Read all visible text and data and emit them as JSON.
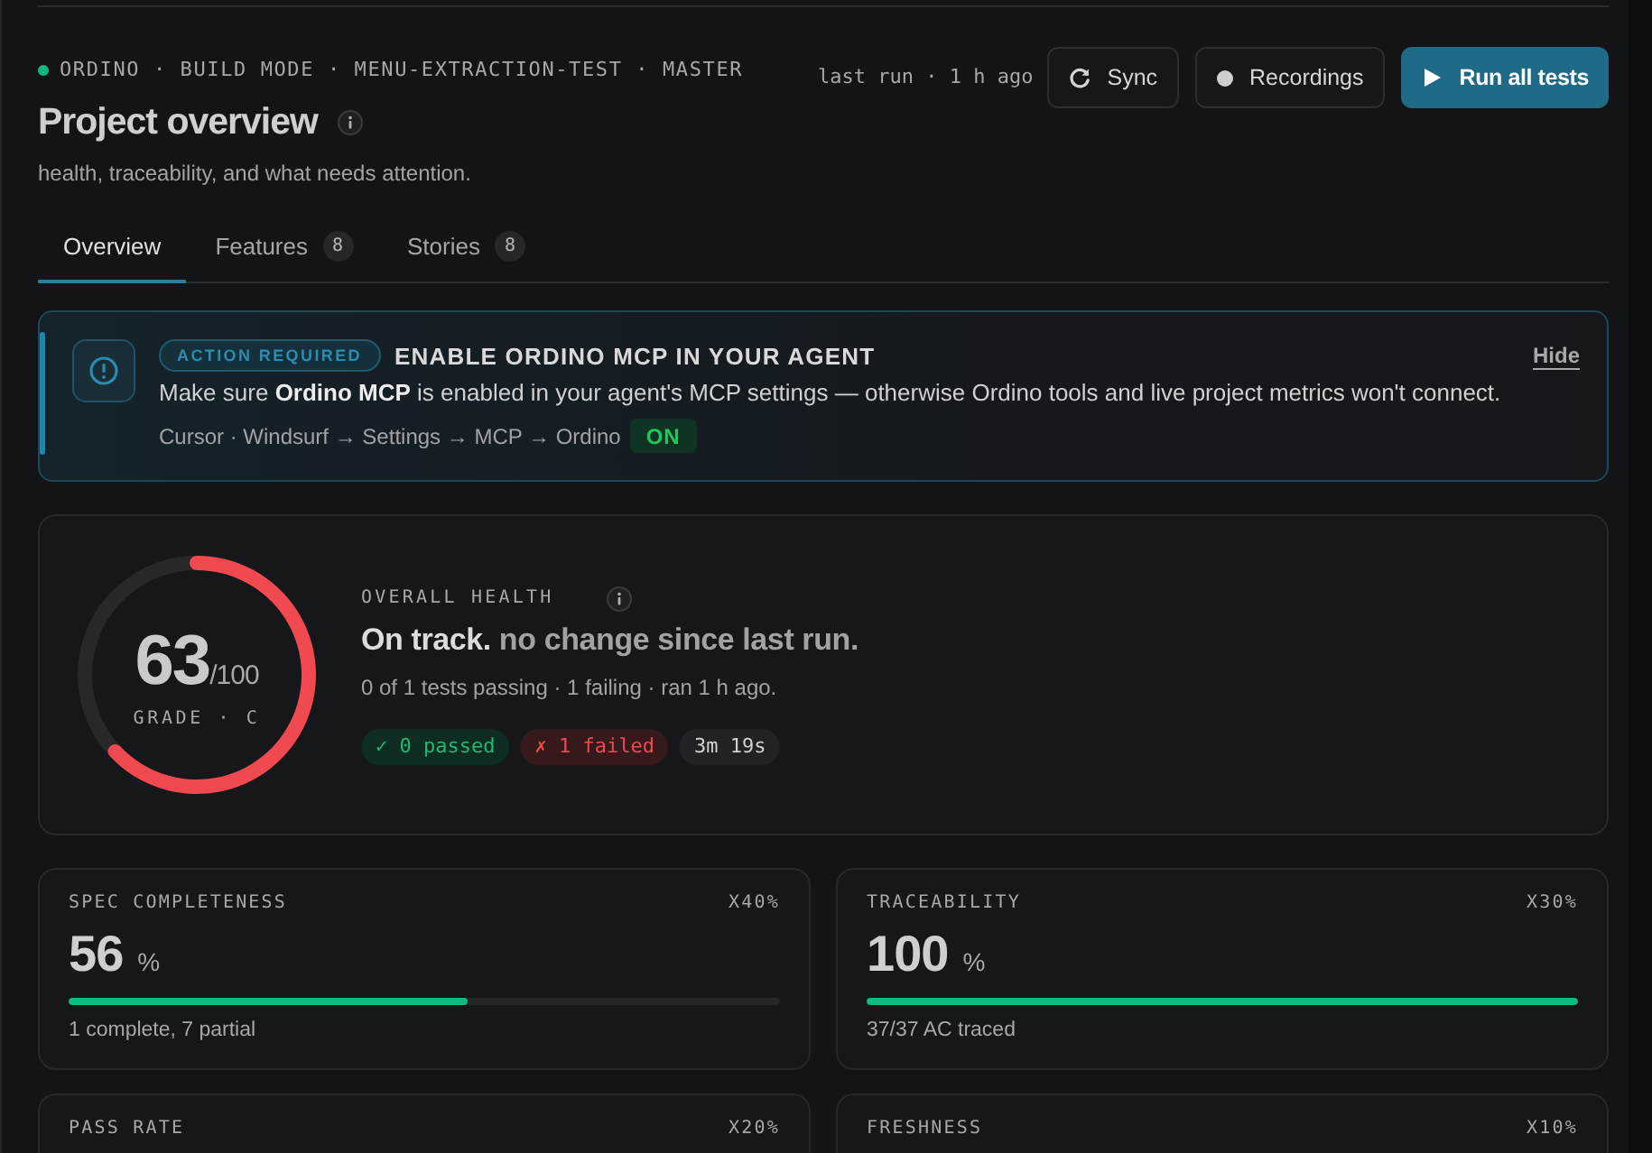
{
  "header": {
    "breadcrumb": "ORDINO · BUILD MODE · MENU-EXTRACTION-TEST · MASTER",
    "title": "Project overview",
    "subtitle": "health, traceability, and what needs attention.",
    "last_run": "last run · 1 h ago",
    "actions": [
      {
        "kind": "sync",
        "label": "Sync"
      },
      {
        "kind": "recordings",
        "label": "Recordings"
      },
      {
        "kind": "primary",
        "label": "Run all tests"
      }
    ]
  },
  "tabs": [
    {
      "label": "Overview",
      "selected": true
    },
    {
      "label": "Features",
      "count": "8",
      "selected": false
    },
    {
      "label": "Stories",
      "count": "8",
      "selected": false
    }
  ],
  "alert": {
    "badge": "ACTION REQUIRED",
    "title": "ENABLE ORDINO MCP IN YOUR AGENT",
    "dismiss": "Hide",
    "message": "Make sure **Ordino MCP** is enabled in your agent's MCP settings — otherwise Ordino tools and live project metrics won't connect.",
    "path": "Cursor · Windsurf → Settings → MCP → Ordino",
    "status": "ON"
  },
  "health": {
    "chart_data": {
      "type": "donut",
      "values": [
        63,
        37
      ]
    },
    "score": "63",
    "max": "/100",
    "grade": "GRADE · C",
    "label": "OVERALL HEALTH",
    "headline": "**On track.** no change since last run.",
    "summary": "0 of 1 tests passing · 1 failing · ran 1 h ago.",
    "pills": [
      {
        "kind": "passed",
        "text": "✓ 0 passed"
      },
      {
        "kind": "failed",
        "text": "✗ 1 failed"
      },
      {
        "kind": "duration",
        "text": "3m 19s"
      }
    ]
  },
  "metrics": [
    {
      "label": "SPEC COMPLETENESS",
      "weight": "X40%",
      "value": "56",
      "unit": "%",
      "level": 0.56,
      "note": "1 complete, 7 partial"
    },
    {
      "label": "TRACEABILITY",
      "weight": "X30%",
      "value": "100",
      "unit": "%",
      "level": 1,
      "note": "37/37 AC traced"
    },
    {
      "label": "PASS RATE",
      "weight": "X20%"
    },
    {
      "label": "FRESHNESS",
      "weight": "X10%"
    }
  ]
}
